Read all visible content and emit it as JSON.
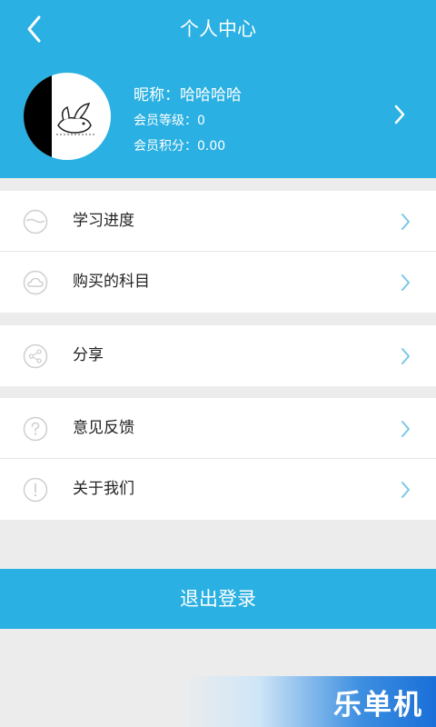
{
  "header": {
    "title": "个人中心",
    "back_icon": "chevron-left-icon"
  },
  "profile": {
    "nickname": "昵称：哈哈哈哈",
    "level": "会员等级：0",
    "points": "会员积分：0.00"
  },
  "menu": {
    "group1": [
      {
        "label": "学习进度",
        "icon": "progress-icon"
      },
      {
        "label": "购买的科目",
        "icon": "cloud-icon"
      }
    ],
    "group2": [
      {
        "label": "分享",
        "icon": "share-icon"
      }
    ],
    "group3": [
      {
        "label": "意见反馈",
        "icon": "question-icon"
      },
      {
        "label": "关于我们",
        "icon": "info-icon"
      }
    ]
  },
  "logout_label": "退出登录",
  "watermark": "乐单机",
  "colors": {
    "primary": "#2ab0e2",
    "background": "#ececec",
    "chevron": "#7ac7ea"
  }
}
